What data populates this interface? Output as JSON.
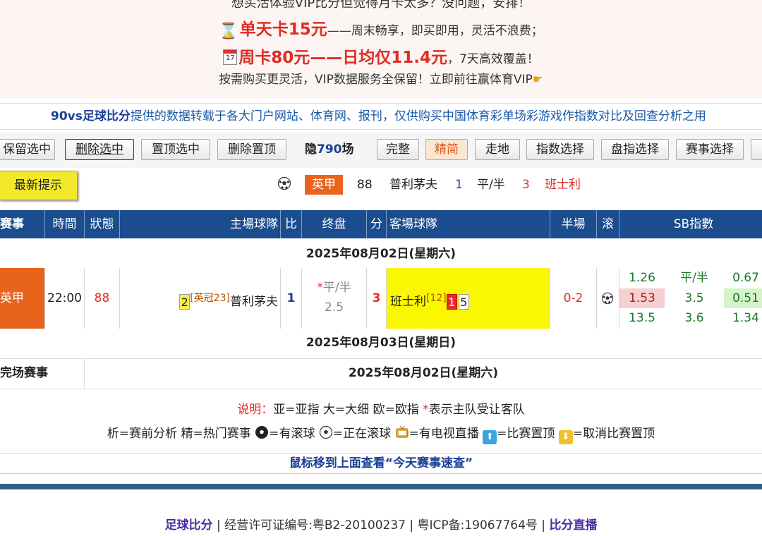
{
  "promo": {
    "line0": "想买活体验VIP比分但觉得月卡太多？没问题，安排！",
    "day_card_big": "单天卡15元",
    "day_card_rest": "——周末畅享，即买即用，灵活不浪费；",
    "week_card_big": "周卡80元——日均仅11.4元",
    "week_card_rest": "，7天高效覆盖！",
    "line3": "按需购买更灵活，VIP数据服务全保留！立即前往赢体育VIP",
    "calendar_day": "17"
  },
  "notice": {
    "brand": "90vs足球比分",
    "text": "提供的数据转载于各大门户网站、体育网、报刊，仅供购买中国体育彩单场彩游戏作指数对比及回查分析之用"
  },
  "toolbar": {
    "keep_selected": "保留选中",
    "delete_selected": "删除选中",
    "pin_selected": "置顶选中",
    "delete_pinned": "删除置顶",
    "hidden_prefix": "隐",
    "hidden_count": "790",
    "hidden_suffix": "场",
    "full": "完整",
    "compact": "精简",
    "walkover": "走地",
    "odds_select": "指数选择",
    "handicap_select": "盘指选择",
    "event_select": "赛事选择"
  },
  "tip": {
    "button": "最新提示",
    "league": "英甲",
    "minute": "88",
    "home": "普利茅夫",
    "home_score": "1",
    "line": "平/半",
    "away_score": "3",
    "away": "班士利"
  },
  "table": {
    "headers": {
      "event": "赛事",
      "time": "時間",
      "status": "狀態",
      "home": "主場球隊",
      "score": "比",
      "final_line": "终盘",
      "score2": "分",
      "away": "客場球隊",
      "half": "半場",
      "live": "滚",
      "sb": "SB指數"
    },
    "date1": "2025年08月02日(星期六)",
    "match": {
      "league": "英甲",
      "time": "22:00",
      "status": "88",
      "home_yellow": "2",
      "home_rank": "[英冠23]",
      "home": "普利茅夫",
      "home_score": "1",
      "line_star": "*",
      "line_text": "平/半",
      "line_value": "2.5",
      "away_score": "3",
      "away": "班士利",
      "away_rank": "[12]",
      "away_red": "1",
      "away_yellow": "5",
      "half": "0-2",
      "odds": [
        [
          "1.26",
          "平/半",
          "0.67"
        ],
        [
          "1.53",
          "3.5",
          "0.51"
        ],
        [
          "13.5",
          "3.6",
          "1.34"
        ]
      ]
    },
    "date2": "2025年08月03日(星期日)",
    "finished_label": "完场赛事",
    "finished_date": "2025年08月02日(星期六)"
  },
  "legend": {
    "label": "说明：",
    "text_a": "亚=亚指 大=大细 欧=欧指 ",
    "star": "*",
    "text_b": "表示主队受让客队",
    "l2_a": "析=赛前分析 精=热门赛事 ",
    "l2_b": "=有滚球 ",
    "l2_c": "=正在滚球 ",
    "l2_d": "=有电视直播 ",
    "l2_e": "=比赛置顶 ",
    "l2_f": "=取消比赛置顶"
  },
  "mouse_tip": "鼠标移到上面查看“今天赛事速查”",
  "footer": {
    "left_link": "足球比分",
    "middle": " | 经营许可证编号:粤B2-20100237 | 粤ICP备:19067764号 | ",
    "right_link": "比分直播"
  },
  "colors": {
    "header_blue": "#1b4c8e",
    "league_orange": "#e8641d",
    "highlight_yellow": "#fbf700",
    "promo_red": "#e02d24"
  }
}
